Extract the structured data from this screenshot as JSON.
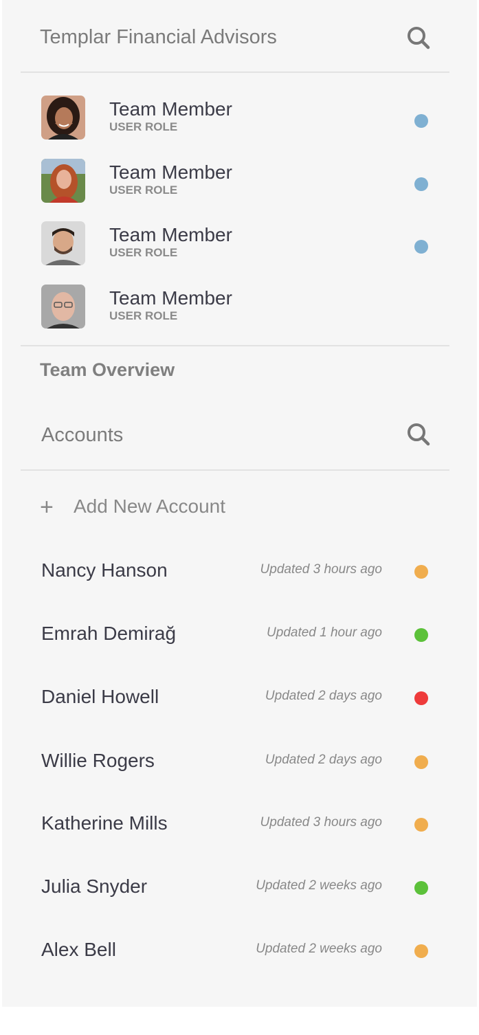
{
  "team": {
    "title": "Templar Financial Advisors",
    "search_icon": "search-icon",
    "members": [
      {
        "name": "Team Member",
        "role": "USER ROLE",
        "status_color": "#7fb0d2",
        "avatar": "avatar-woman-dark-hair"
      },
      {
        "name": "Team Member",
        "role": "USER ROLE",
        "status_color": "#7fb0d2",
        "avatar": "avatar-woman-red-hair"
      },
      {
        "name": "Team Member",
        "role": "USER ROLE",
        "status_color": "#7fb0d2",
        "avatar": "avatar-man-beard"
      },
      {
        "name": "Team Member",
        "role": "USER ROLE",
        "status_color": null,
        "avatar": "avatar-man-glasses"
      }
    ],
    "overview_label": "Team Overview"
  },
  "accounts": {
    "title": "Accounts",
    "search_icon": "search-icon",
    "add_label": "Add New Account",
    "add_icon": "plus-icon",
    "items": [
      {
        "name": "Nancy Hanson",
        "updated": "Updated 3 hours ago",
        "status_color": "#f0ad4e"
      },
      {
        "name": "Emrah Demirağ",
        "updated": "Updated 1 hour ago",
        "status_color": "#5cc13a"
      },
      {
        "name": "Daniel Howell",
        "updated": "Updated 2 days ago",
        "status_color": "#ee3b3b"
      },
      {
        "name": "Willie Rogers",
        "updated": "Updated 2 days ago",
        "status_color": "#f0ad4e"
      },
      {
        "name": "Katherine Mills",
        "updated": "Updated 3 hours ago",
        "status_color": "#f0ad4e"
      },
      {
        "name": "Julia Snyder",
        "updated": "Updated 2 weeks ago",
        "status_color": "#5cc13a"
      },
      {
        "name": "Alex Bell",
        "updated": "Updated 2 weeks ago",
        "status_color": "#f0ad4e"
      }
    ]
  }
}
